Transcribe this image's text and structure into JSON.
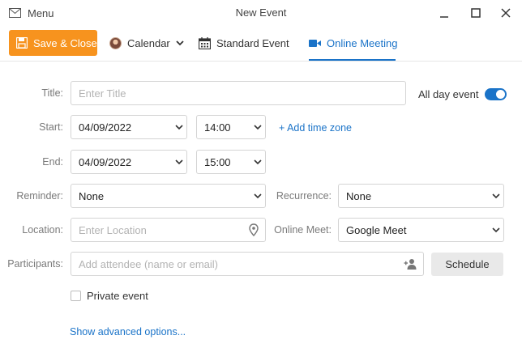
{
  "window": {
    "title": "New Event",
    "menu_label": "Menu"
  },
  "toolbar": {
    "save_label": "Save & Close",
    "calendar_label": "Calendar",
    "standard_event_label": "Standard Event",
    "online_meeting_label": "Online Meeting",
    "active_tab": "Online Meeting"
  },
  "form": {
    "title": {
      "label": "Title:",
      "placeholder": "Enter Title",
      "value": ""
    },
    "all_day": {
      "label": "All day event",
      "on": true
    },
    "start": {
      "label": "Start:",
      "date": "04/09/2022",
      "time": "14:00"
    },
    "add_time_zone": "+ Add time zone",
    "end": {
      "label": "End:",
      "date": "04/09/2022",
      "time": "15:00"
    },
    "reminder": {
      "label": "Reminder:",
      "value": "None"
    },
    "recurrence": {
      "label": "Recurrence:",
      "value": "None"
    },
    "location": {
      "label": "Location:",
      "placeholder": "Enter Location",
      "value": ""
    },
    "online_meet": {
      "label": "Online Meet:",
      "value": "Google Meet"
    },
    "participants": {
      "label": "Participants:",
      "placeholder": "Add attendee (name or email)",
      "value": ""
    },
    "schedule_label": "Schedule",
    "private_event": {
      "label": "Private event",
      "checked": false
    },
    "advanced_link": "Show advanced options..."
  },
  "colors": {
    "accent": "#1a73c8",
    "save_button": "#f7931e",
    "label_gray": "#7a7a7a"
  },
  "icons": [
    "mail-icon",
    "minimize-icon",
    "maximize-icon",
    "close-icon",
    "save-icon",
    "chevron-down-icon",
    "calendar-grid-icon",
    "video-camera-icon",
    "location-pin-icon",
    "add-person-icon"
  ]
}
